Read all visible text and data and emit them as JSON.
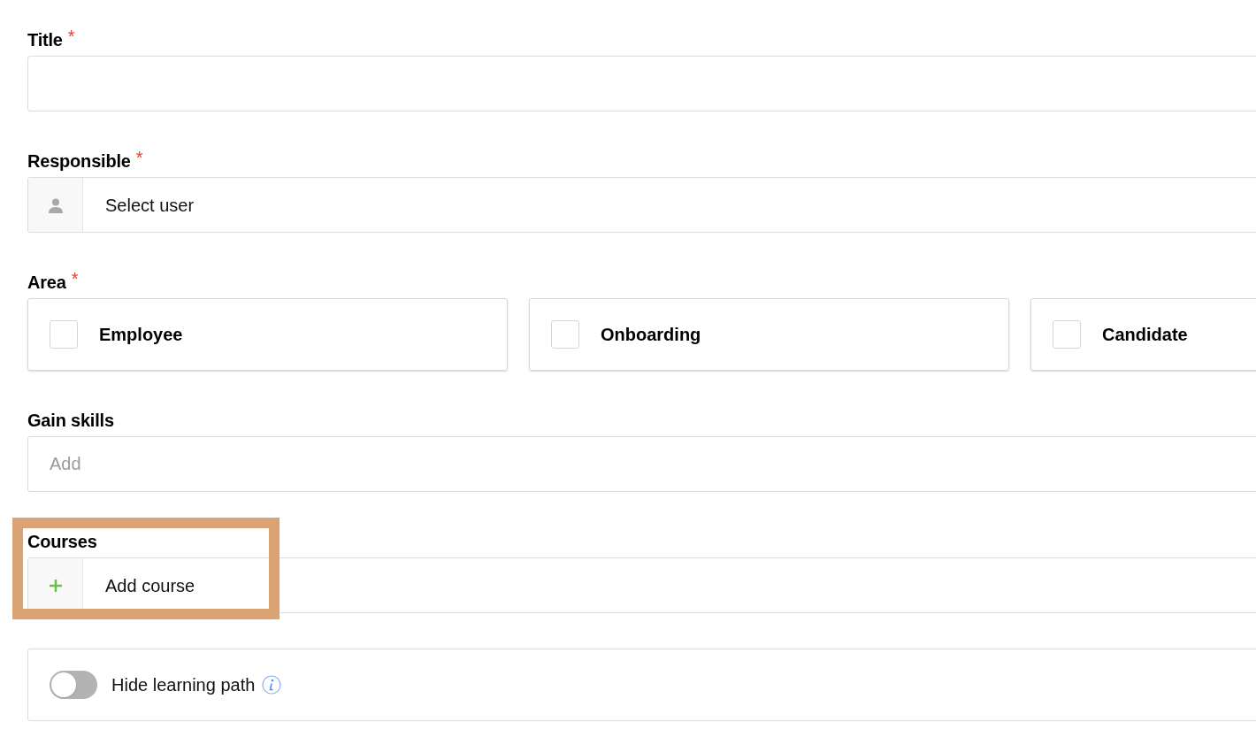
{
  "fields": [
    {
      "kind": "text",
      "label": "Title",
      "required": true
    },
    {
      "kind": "user",
      "label": "Responsible",
      "required": true,
      "value": "Select user"
    },
    {
      "kind": "checkboxes",
      "label": "Area",
      "required": true,
      "options": [
        {
          "label": "Employee",
          "checked": false
        },
        {
          "label": "Onboarding",
          "checked": false
        },
        {
          "label": "Candidate",
          "checked": false
        }
      ]
    },
    {
      "kind": "tags",
      "label": "Gain skills",
      "required": false,
      "placeholder": "Add"
    },
    {
      "kind": "add",
      "label": "Courses",
      "required": false,
      "value": "Add course",
      "highlighted": true
    },
    {
      "kind": "toggle",
      "label": "Hide learning path",
      "on": false
    }
  ],
  "required_mark": "*"
}
